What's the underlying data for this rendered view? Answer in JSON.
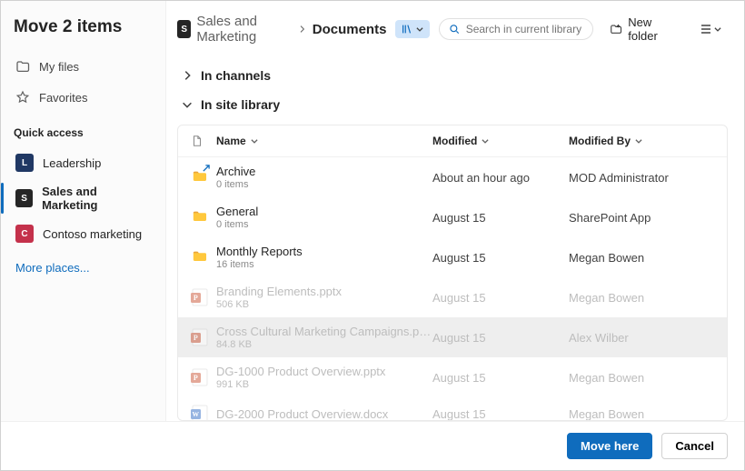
{
  "title": "Move 2 items",
  "sidebar": {
    "myFiles": "My files",
    "favorites": "Favorites",
    "quickAccess": "Quick access",
    "items": [
      {
        "label": "Leadership",
        "color": "#203864",
        "initial": "L"
      },
      {
        "label": "Sales and Marketing",
        "color": "#252525",
        "initial": "S"
      },
      {
        "label": "Contoso marketing",
        "color": "#c4314b",
        "initial": "C"
      }
    ],
    "more": "More places..."
  },
  "breadcrumbs": {
    "site": "Sales and Marketing",
    "library": "Documents"
  },
  "search": {
    "placeholder": "Search in current library"
  },
  "toolbar": {
    "newFolder": "New folder"
  },
  "sections": {
    "channels": "In channels",
    "siteLibrary": "In site library"
  },
  "columns": {
    "name": "Name",
    "modified": "Modified",
    "by": "Modified By"
  },
  "rows": [
    {
      "kind": "folder",
      "name": "Archive",
      "meta": "0 items",
      "modified": "About an hour ago",
      "by": "MOD Administrator",
      "shortcut": true
    },
    {
      "kind": "folder",
      "name": "General",
      "meta": "0 items",
      "modified": "August 15",
      "by": "SharePoint App"
    },
    {
      "kind": "folder",
      "name": "Monthly Reports",
      "meta": "16 items",
      "modified": "August 15",
      "by": "Megan Bowen"
    },
    {
      "kind": "pptx",
      "name": "Branding Elements.pptx",
      "meta": "506 KB",
      "modified": "August 15",
      "by": "Megan Bowen",
      "disabled": true
    },
    {
      "kind": "pptx",
      "name": "Cross Cultural Marketing Campaigns.p…",
      "meta": "84.8 KB",
      "modified": "August 15",
      "by": "Alex Wilber",
      "disabled": true,
      "selected": true
    },
    {
      "kind": "pptx",
      "name": "DG-1000 Product Overview.pptx",
      "meta": "991 KB",
      "modified": "August 15",
      "by": "Megan Bowen",
      "disabled": true
    },
    {
      "kind": "docx",
      "name": "DG-2000 Product Overview.docx",
      "meta": "",
      "modified": "August 15",
      "by": "Megan Bowen",
      "disabled": true
    }
  ],
  "footer": {
    "primary": "Move here",
    "cancel": "Cancel"
  }
}
